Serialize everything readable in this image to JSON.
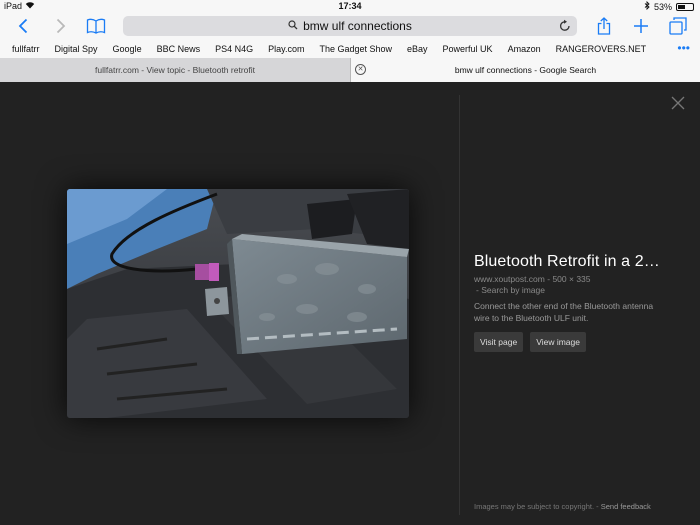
{
  "status": {
    "device": "iPad",
    "time": "17:34",
    "battery_text": "53%",
    "battery_level": 0.53
  },
  "toolbar": {
    "address": "bmw ulf connections"
  },
  "bookmarks": [
    "fullfatrr",
    "Digital Spy",
    "Google",
    "BBC News",
    "PS4 N4G",
    "Play.com",
    "The Gadget Show",
    "eBay",
    "Powerful UK",
    "Amazon",
    "RANGEROVERS.NET"
  ],
  "tabs": [
    {
      "label": "fullfatrr.com - View topic - Bluetooth retrofit",
      "active": false
    },
    {
      "label": "bmw ulf connections - Google Search",
      "active": true
    }
  ],
  "viewer": {
    "title": "Bluetooth Retrofit in a 2…",
    "source": "www.xoutpost.com",
    "dimensions": "500 × 335",
    "search_by_image": "Search by image",
    "description": "Connect the other end of the Bluetooth antenna wire to the Bluetooth ULF unit.",
    "visit_page": "Visit page",
    "view_image": "View image",
    "copyright": "Images may be subject to copyright.",
    "feedback": "Send feedback"
  },
  "colors": {
    "accent": "#1a7cf5",
    "viewer_bg": "#222222"
  }
}
